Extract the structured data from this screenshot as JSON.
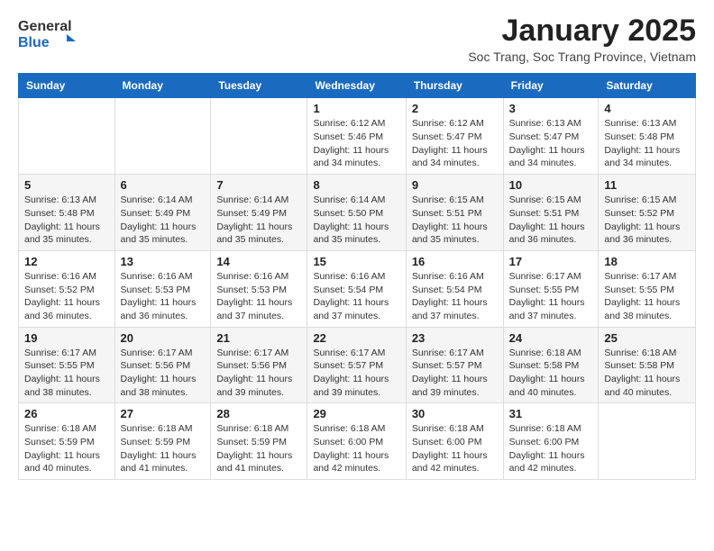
{
  "header": {
    "logo": {
      "general": "General",
      "blue": "Blue"
    },
    "title": "January 2025",
    "subtitle": "Soc Trang, Soc Trang Province, Vietnam"
  },
  "days_of_week": [
    "Sunday",
    "Monday",
    "Tuesday",
    "Wednesday",
    "Thursday",
    "Friday",
    "Saturday"
  ],
  "weeks": [
    [
      {
        "day": null,
        "info": null
      },
      {
        "day": null,
        "info": null
      },
      {
        "day": null,
        "info": null
      },
      {
        "day": "1",
        "info": "Sunrise: 6:12 AM\nSunset: 5:46 PM\nDaylight: 11 hours\nand 34 minutes."
      },
      {
        "day": "2",
        "info": "Sunrise: 6:12 AM\nSunset: 5:47 PM\nDaylight: 11 hours\nand 34 minutes."
      },
      {
        "day": "3",
        "info": "Sunrise: 6:13 AM\nSunset: 5:47 PM\nDaylight: 11 hours\nand 34 minutes."
      },
      {
        "day": "4",
        "info": "Sunrise: 6:13 AM\nSunset: 5:48 PM\nDaylight: 11 hours\nand 34 minutes."
      }
    ],
    [
      {
        "day": "5",
        "info": "Sunrise: 6:13 AM\nSunset: 5:48 PM\nDaylight: 11 hours\nand 35 minutes."
      },
      {
        "day": "6",
        "info": "Sunrise: 6:14 AM\nSunset: 5:49 PM\nDaylight: 11 hours\nand 35 minutes."
      },
      {
        "day": "7",
        "info": "Sunrise: 6:14 AM\nSunset: 5:49 PM\nDaylight: 11 hours\nand 35 minutes."
      },
      {
        "day": "8",
        "info": "Sunrise: 6:14 AM\nSunset: 5:50 PM\nDaylight: 11 hours\nand 35 minutes."
      },
      {
        "day": "9",
        "info": "Sunrise: 6:15 AM\nSunset: 5:51 PM\nDaylight: 11 hours\nand 35 minutes."
      },
      {
        "day": "10",
        "info": "Sunrise: 6:15 AM\nSunset: 5:51 PM\nDaylight: 11 hours\nand 36 minutes."
      },
      {
        "day": "11",
        "info": "Sunrise: 6:15 AM\nSunset: 5:52 PM\nDaylight: 11 hours\nand 36 minutes."
      }
    ],
    [
      {
        "day": "12",
        "info": "Sunrise: 6:16 AM\nSunset: 5:52 PM\nDaylight: 11 hours\nand 36 minutes."
      },
      {
        "day": "13",
        "info": "Sunrise: 6:16 AM\nSunset: 5:53 PM\nDaylight: 11 hours\nand 36 minutes."
      },
      {
        "day": "14",
        "info": "Sunrise: 6:16 AM\nSunset: 5:53 PM\nDaylight: 11 hours\nand 37 minutes."
      },
      {
        "day": "15",
        "info": "Sunrise: 6:16 AM\nSunset: 5:54 PM\nDaylight: 11 hours\nand 37 minutes."
      },
      {
        "day": "16",
        "info": "Sunrise: 6:16 AM\nSunset: 5:54 PM\nDaylight: 11 hours\nand 37 minutes."
      },
      {
        "day": "17",
        "info": "Sunrise: 6:17 AM\nSunset: 5:55 PM\nDaylight: 11 hours\nand 37 minutes."
      },
      {
        "day": "18",
        "info": "Sunrise: 6:17 AM\nSunset: 5:55 PM\nDaylight: 11 hours\nand 38 minutes."
      }
    ],
    [
      {
        "day": "19",
        "info": "Sunrise: 6:17 AM\nSunset: 5:55 PM\nDaylight: 11 hours\nand 38 minutes."
      },
      {
        "day": "20",
        "info": "Sunrise: 6:17 AM\nSunset: 5:56 PM\nDaylight: 11 hours\nand 38 minutes."
      },
      {
        "day": "21",
        "info": "Sunrise: 6:17 AM\nSunset: 5:56 PM\nDaylight: 11 hours\nand 39 minutes."
      },
      {
        "day": "22",
        "info": "Sunrise: 6:17 AM\nSunset: 5:57 PM\nDaylight: 11 hours\nand 39 minutes."
      },
      {
        "day": "23",
        "info": "Sunrise: 6:17 AM\nSunset: 5:57 PM\nDaylight: 11 hours\nand 39 minutes."
      },
      {
        "day": "24",
        "info": "Sunrise: 6:18 AM\nSunset: 5:58 PM\nDaylight: 11 hours\nand 40 minutes."
      },
      {
        "day": "25",
        "info": "Sunrise: 6:18 AM\nSunset: 5:58 PM\nDaylight: 11 hours\nand 40 minutes."
      }
    ],
    [
      {
        "day": "26",
        "info": "Sunrise: 6:18 AM\nSunset: 5:59 PM\nDaylight: 11 hours\nand 40 minutes."
      },
      {
        "day": "27",
        "info": "Sunrise: 6:18 AM\nSunset: 5:59 PM\nDaylight: 11 hours\nand 41 minutes."
      },
      {
        "day": "28",
        "info": "Sunrise: 6:18 AM\nSunset: 5:59 PM\nDaylight: 11 hours\nand 41 minutes."
      },
      {
        "day": "29",
        "info": "Sunrise: 6:18 AM\nSunset: 6:00 PM\nDaylight: 11 hours\nand 42 minutes."
      },
      {
        "day": "30",
        "info": "Sunrise: 6:18 AM\nSunset: 6:00 PM\nDaylight: 11 hours\nand 42 minutes."
      },
      {
        "day": "31",
        "info": "Sunrise: 6:18 AM\nSunset: 6:00 PM\nDaylight: 11 hours\nand 42 minutes."
      },
      {
        "day": null,
        "info": null
      }
    ]
  ]
}
